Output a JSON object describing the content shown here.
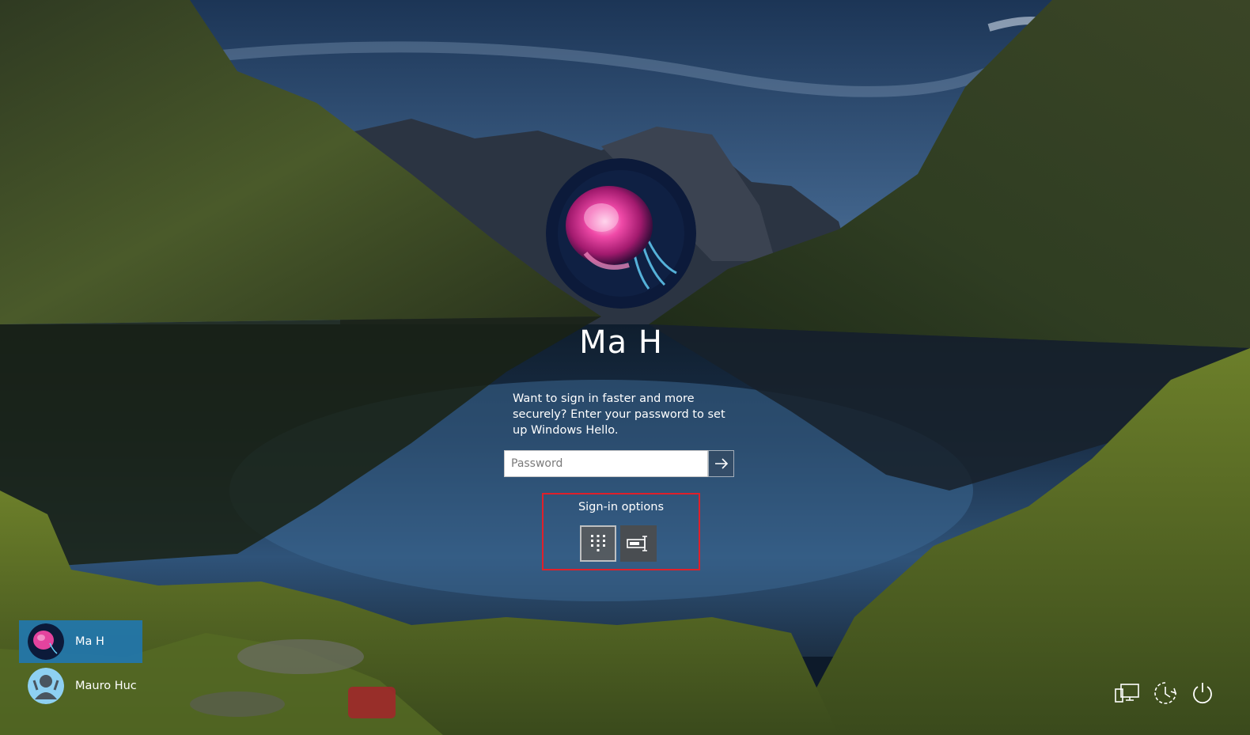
{
  "lock_screen": {
    "user_name": "Ma H",
    "hello_message": "Want to sign in faster and more securely? Enter your password to set up Windows Hello.",
    "password_placeholder": "Password",
    "submit_icon": "arrow-right-icon",
    "signin_options_label": "Sign-in options",
    "signin_options": [
      {
        "icon": "pin-keypad-icon",
        "selected": true
      },
      {
        "icon": "password-key-icon",
        "selected": false
      }
    ],
    "highlight_color": "#e0202a"
  },
  "user_list": [
    {
      "name": "Ma H",
      "avatar": "jellyfish-avatar",
      "selected": true
    },
    {
      "name": "Mauro Huc",
      "avatar": "person-avatar",
      "selected": false
    }
  ],
  "system_buttons": [
    {
      "icon": "network-icon"
    },
    {
      "icon": "ease-of-access-icon"
    },
    {
      "icon": "power-icon"
    }
  ],
  "colors": {
    "selected_tile": "#1f78b4",
    "text": "#ffffff"
  }
}
